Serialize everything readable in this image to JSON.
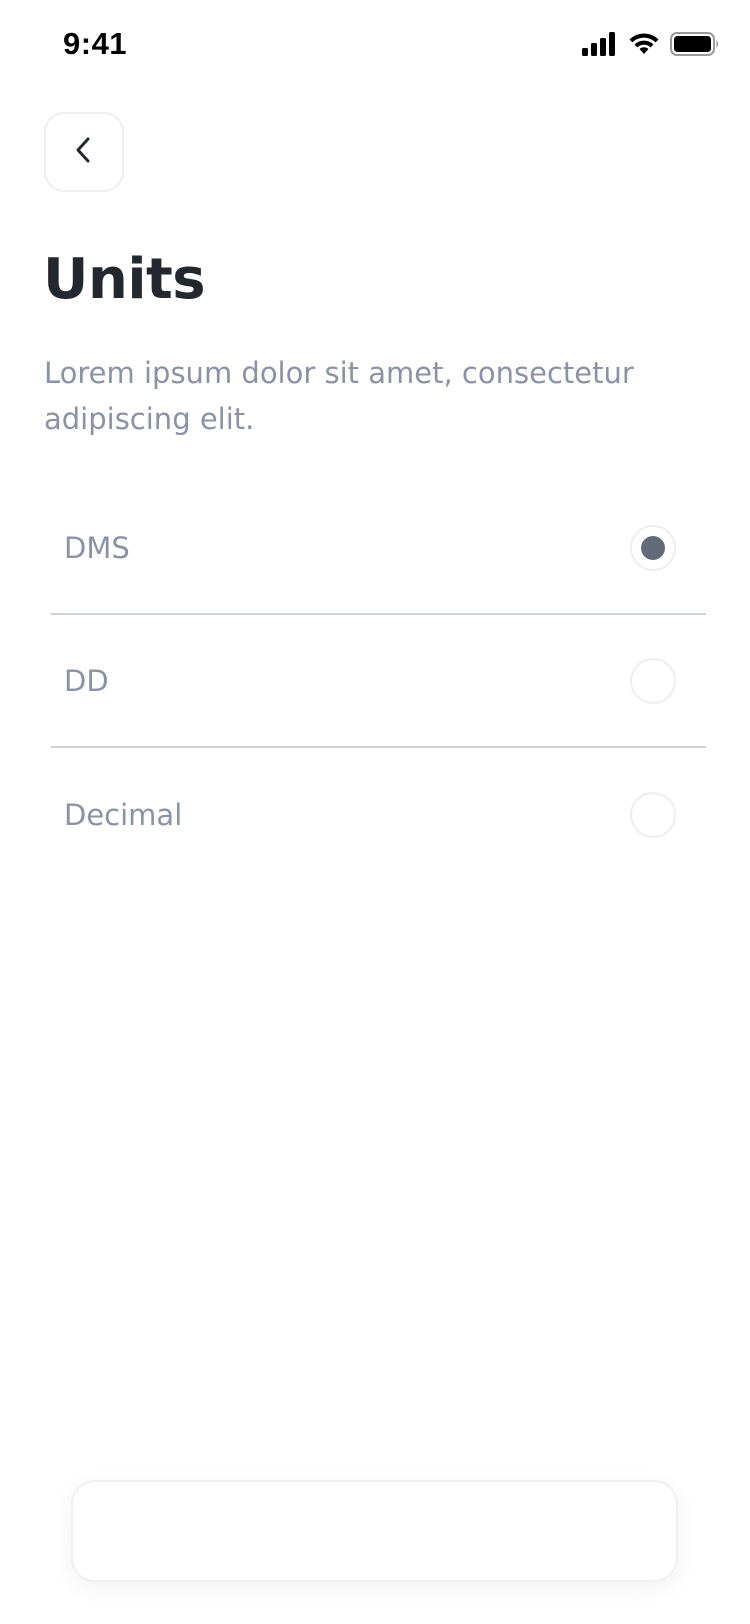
{
  "status_bar": {
    "time": "9:41"
  },
  "header": {
    "back_icon": "chevron-left-icon",
    "title": "Units",
    "description": "Lorem ipsum dolor sit amet, consectetur adipiscing elit."
  },
  "options": [
    {
      "label": "DMS",
      "selected": true
    },
    {
      "label": "DD",
      "selected": false
    },
    {
      "label": "Decimal",
      "selected": false
    }
  ],
  "colors": {
    "title": "#232730",
    "muted_text": "#8a93a6",
    "radio_selected": "#636a79",
    "divider": "#cfd3d9"
  }
}
